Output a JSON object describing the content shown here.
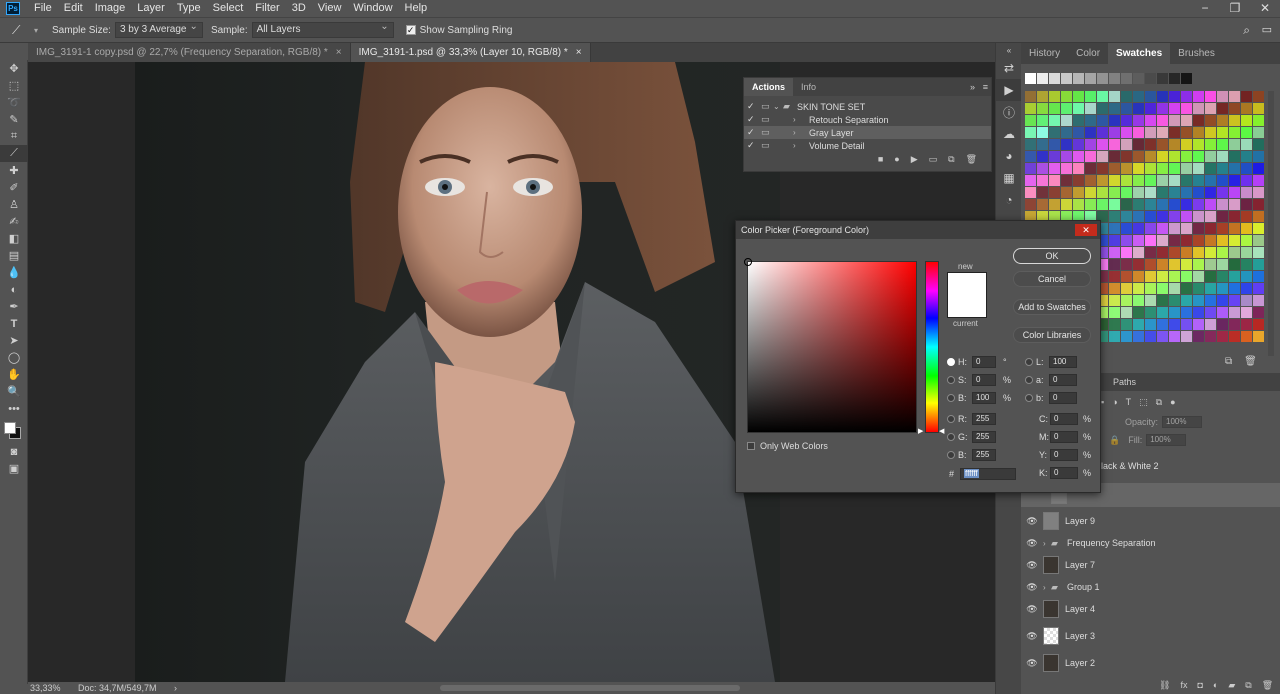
{
  "menu": [
    "File",
    "Edit",
    "Image",
    "Layer",
    "Type",
    "Select",
    "Filter",
    "3D",
    "View",
    "Window",
    "Help"
  ],
  "window_controls": {
    "minimize": "−",
    "restore": "❐",
    "close": "✕"
  },
  "options": {
    "sample_size_label": "Sample Size:",
    "sample_size_value": "3 by 3 Average",
    "sample_label": "Sample:",
    "sample_value": "All Layers",
    "show_ring_label": "Show Sampling Ring"
  },
  "doc_tabs": [
    {
      "label": "IMG_3191-1 copy.psd @ 22,7% (Frequency Separation, RGB/8) *",
      "active": false
    },
    {
      "label": "IMG_3191-1.psd @ 33,3% (Layer 10, RGB/8) *",
      "active": true
    }
  ],
  "status": {
    "zoom": "33,33%",
    "doc": "Doc: 34,7M/549,7M"
  },
  "actions_panel": {
    "tabs": [
      "Actions",
      "Info"
    ],
    "set_name": "SKIN TONE SET",
    "items": [
      "Retouch Separation",
      "Gray Layer",
      "Volume Detail"
    ]
  },
  "right_panel": {
    "tabs": [
      "History",
      "Color",
      "Swatches",
      "Brushes"
    ],
    "active_tab": "Swatches",
    "paths_tab": "Paths"
  },
  "layers_panel": {
    "opacity_label": "Opacity:",
    "opacity_value": "100%",
    "fill_label": "Fill:",
    "fill_value": "100%",
    "layers": [
      {
        "name": "lack & White 2"
      },
      {
        "name": "Layer 9"
      },
      {
        "name": "Frequency Separation"
      },
      {
        "name": "Layer 7"
      },
      {
        "name": "Group 1"
      },
      {
        "name": "Layer 4"
      },
      {
        "name": "Layer 3"
      },
      {
        "name": "Layer 2"
      }
    ]
  },
  "color_picker": {
    "title": "Color Picker (Foreground Color)",
    "ok": "OK",
    "cancel": "Cancel",
    "add_to_swatches": "Add to Swatches",
    "color_libraries": "Color Libraries",
    "new_label": "new",
    "current_label": "current",
    "only_web_colors": "Only Web Colors",
    "hsb": {
      "H": "0",
      "S": "0",
      "B": "100"
    },
    "hsb_units": {
      "H": "°",
      "S": "%",
      "B": "%"
    },
    "rgb": {
      "R": "255",
      "G": "255",
      "B": "255"
    },
    "lab": {
      "L": "100",
      "a": "0",
      "b": "0"
    },
    "cmyk": {
      "C": "0",
      "M": "0",
      "Y": "0",
      "K": "0"
    },
    "cmyk_unit": "%",
    "hex": "ffffff",
    "hex_label": "#",
    "labels": {
      "H": "H:",
      "S": "S:",
      "B": "B:",
      "R": "R:",
      "G": "G:",
      "B2": "B:",
      "L": "L:",
      "a": "a:",
      "b": "b:",
      "C": "C:",
      "M": "M:",
      "Y": "Y:",
      "K": "K:"
    }
  },
  "colors": {
    "accent": "#31a8ff",
    "selection": "#6b8fc4"
  }
}
